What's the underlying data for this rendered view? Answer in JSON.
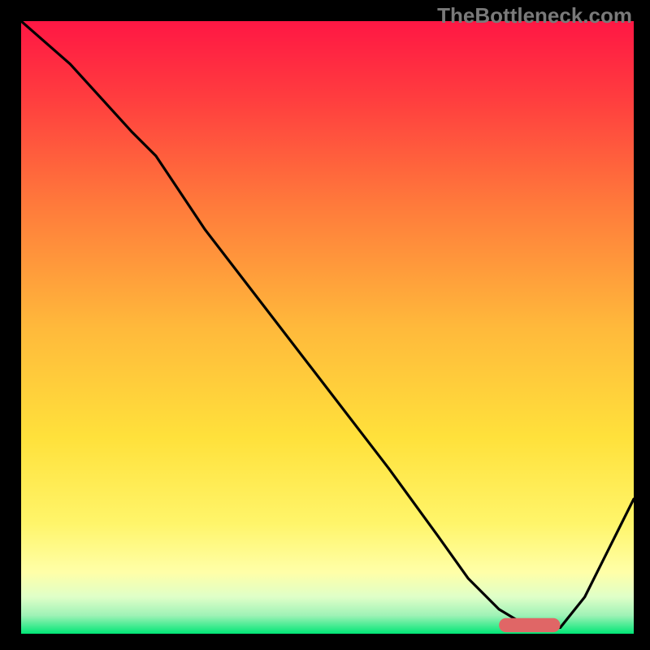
{
  "watermark": "TheBottleneck.com",
  "chart_data": {
    "type": "line",
    "title": "",
    "xlabel": "",
    "ylabel": "",
    "xlim": [
      0,
      100
    ],
    "ylim": [
      0,
      100
    ],
    "grid": false,
    "legend": false,
    "background_gradient": {
      "stops": [
        {
          "pos": 0.0,
          "color": "#ff1744"
        },
        {
          "pos": 0.12,
          "color": "#ff3b3f"
        },
        {
          "pos": 0.3,
          "color": "#ff7a3b"
        },
        {
          "pos": 0.5,
          "color": "#ffb93b"
        },
        {
          "pos": 0.68,
          "color": "#ffe13b"
        },
        {
          "pos": 0.82,
          "color": "#fff56a"
        },
        {
          "pos": 0.9,
          "color": "#ffffa8"
        },
        {
          "pos": 0.94,
          "color": "#dfffc8"
        },
        {
          "pos": 0.97,
          "color": "#9ff2b6"
        },
        {
          "pos": 1.0,
          "color": "#00e676"
        }
      ]
    },
    "series": [
      {
        "name": "curve",
        "color": "#000000",
        "x": [
          0,
          8,
          18,
          22,
          30,
          40,
          50,
          60,
          68,
          73,
          78,
          83,
          85,
          88,
          92,
          96,
          100
        ],
        "y": [
          100,
          93,
          82,
          78,
          66,
          53,
          40,
          27,
          16,
          9,
          4,
          1,
          1,
          1,
          6,
          14,
          22
        ]
      }
    ],
    "marker": {
      "name": "optimal-range",
      "color": "#e06666",
      "x_start": 78,
      "x_end": 88,
      "y": 1.4,
      "thickness": 2.3
    }
  }
}
